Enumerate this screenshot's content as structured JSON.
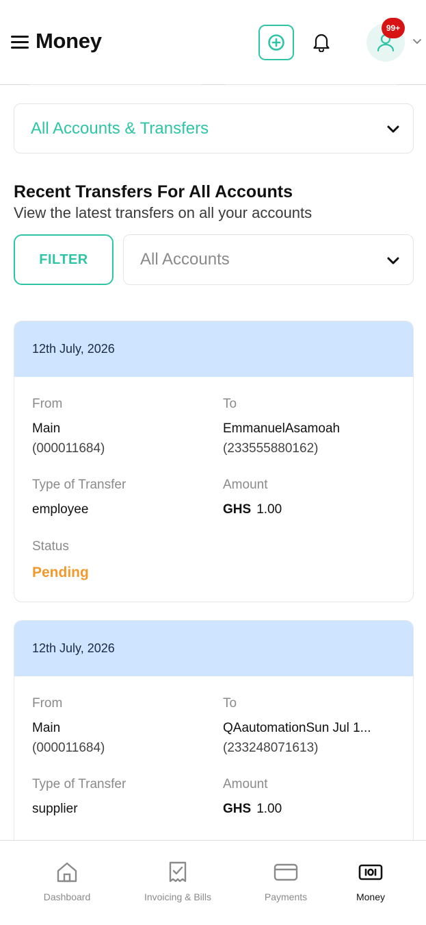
{
  "header": {
    "title": "Money",
    "notification_badge": "99+"
  },
  "account_selector": {
    "selected": "All Accounts & Transfers"
  },
  "section": {
    "title": "Recent Transfers For All Accounts",
    "subtitle": "View the latest transfers on all your accounts"
  },
  "filters": {
    "filter_button": "FILTER",
    "accounts_select": "All Accounts"
  },
  "labels": {
    "from": "From",
    "to": "To",
    "type": "Type of Transfer",
    "amount": "Amount",
    "status": "Status"
  },
  "transfers": [
    {
      "date": "12th July, 2026",
      "from_name": "Main",
      "from_account": "(000011684)",
      "to_name": "EmmanuelAsamoah",
      "to_account": "(233555880162)",
      "type": "employee",
      "currency": "GHS",
      "amount": "1.00",
      "status": "Pending"
    },
    {
      "date": "12th July, 2026",
      "from_name": "Main",
      "from_account": "(000011684)",
      "to_name": "QAautomationSun Jul 1...",
      "to_account": "(233248071613)",
      "type": "supplier",
      "currency": "GHS",
      "amount": "1.00"
    }
  ],
  "nav": {
    "items": [
      {
        "label": "Dashboard",
        "icon": "home-icon"
      },
      {
        "label": "Invoicing & Bills",
        "icon": "receipt-check-icon"
      },
      {
        "label": "Payments",
        "icon": "card-icon"
      },
      {
        "label": "Money",
        "icon": "banknote-icon"
      }
    ],
    "active": "Money"
  },
  "colors": {
    "accent": "#2ec4a6",
    "card_header": "#cfe4ff",
    "pending": "#f09a2e",
    "badge": "#d81313"
  }
}
